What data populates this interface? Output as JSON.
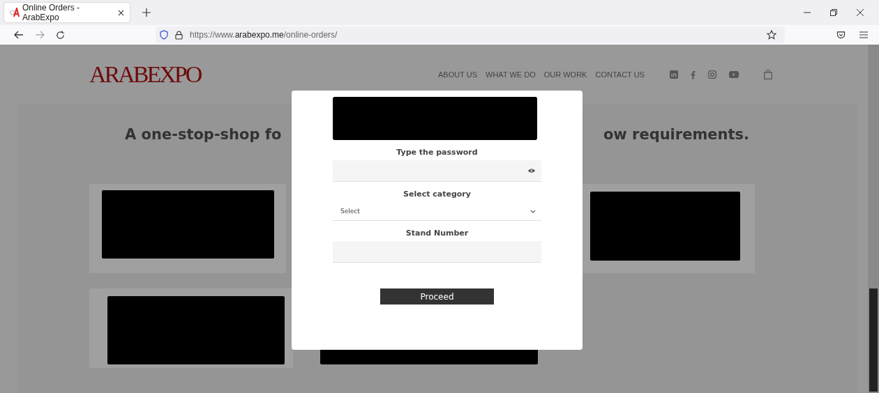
{
  "browser": {
    "tab": {
      "title": "Online Orders - ArabExpo",
      "selected": true
    },
    "url": {
      "prefix": "https://www.",
      "host": "arabexpo.me",
      "path": "/online-orders/"
    }
  },
  "site": {
    "logo": "ARABEXPO",
    "nav": [
      "ABOUT US",
      "WHAT WE DO",
      "OUR WORK",
      "CONTACT US"
    ],
    "heading_left": "A one-stop-shop fo",
    "heading_right": "ow requirements."
  },
  "modal": {
    "fields": [
      {
        "kind": "password",
        "label": "Type the password"
      },
      {
        "kind": "select",
        "label": "Select category",
        "value": "Select"
      },
      {
        "kind": "text",
        "label": "Stand Number"
      }
    ],
    "button": "Proceed"
  }
}
